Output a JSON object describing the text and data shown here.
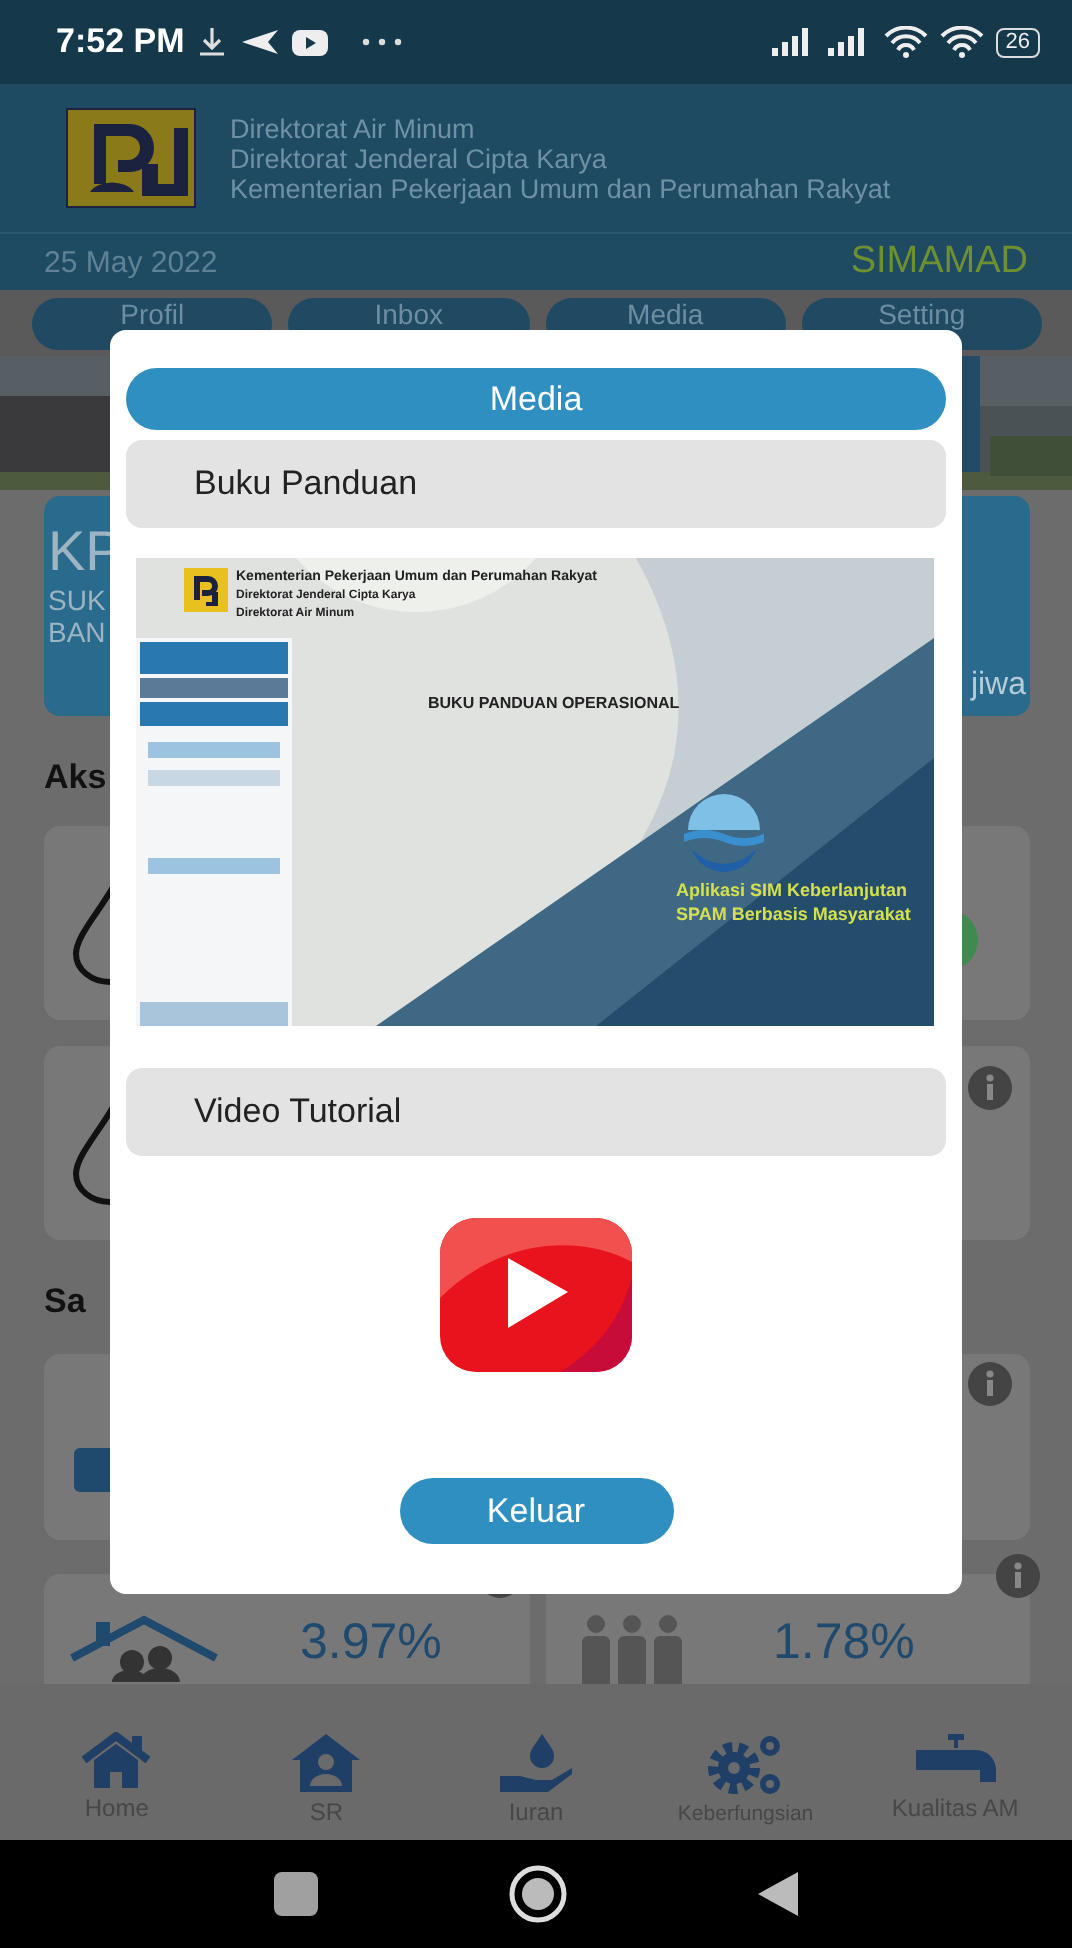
{
  "status_bar": {
    "time": "7:52 PM",
    "battery": "26"
  },
  "header": {
    "lines": [
      "Direktorat Air Minum",
      "Direktorat Jenderal Cipta Karya",
      "Kementerian Pekerjaan Umum dan Perumahan Rakyat"
    ],
    "date": "25 May 2022",
    "app_name": "SIMAMAD"
  },
  "tabs": [
    {
      "label": "Profil"
    },
    {
      "label": "Inbox"
    },
    {
      "label": "Media"
    },
    {
      "label": "Setting"
    }
  ],
  "summary_card": {
    "title": "KP",
    "line_1": "SUK",
    "line_2": "BAN",
    "unit": "jiwa"
  },
  "sections": [
    {
      "heading": "Aks"
    },
    {
      "heading": "Sa"
    }
  ],
  "stats": [
    {
      "value": "3.97%"
    },
    {
      "value": "1.78%"
    }
  ],
  "dialog": {
    "title": "Media",
    "items": [
      {
        "kind": "document",
        "label": "Buku Panduan",
        "cover": {
          "org_lines": [
            "Kementerian Pekerjaan Umum dan Perumahan Rakyat",
            "Direktorat Jenderal Cipta Karya",
            "Direktorat Air Minum"
          ],
          "title": "BUKU PANDUAN OPERASIONAL",
          "subtitle_lines": [
            "Aplikasi SIM Keberlanjutan",
            "SPAM Berbasis Masyarakat"
          ]
        }
      },
      {
        "kind": "video",
        "label": "Video Tutorial"
      }
    ],
    "close_button": "Keluar"
  },
  "bottom_nav": [
    {
      "label": "Home"
    },
    {
      "label": "SR"
    },
    {
      "label": "Iuran"
    },
    {
      "label": "Keberfungsian"
    },
    {
      "label": "Kualitas AM"
    }
  ]
}
